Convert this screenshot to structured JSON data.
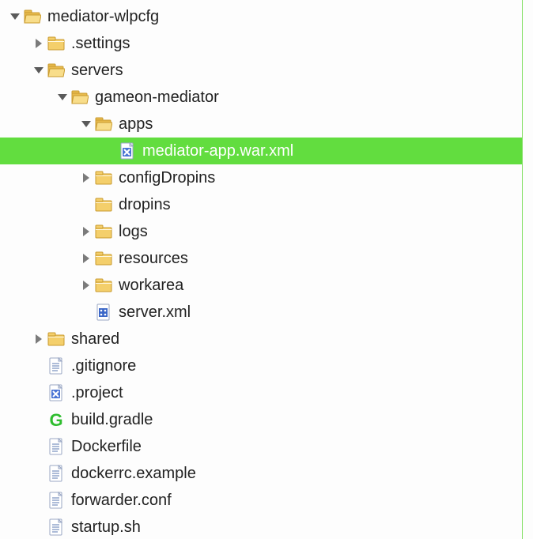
{
  "tree": [
    {
      "depth": 0,
      "arrow": "down",
      "icon": "folder-open",
      "label": "mediator-wlpcfg",
      "interact": true,
      "selected": false
    },
    {
      "depth": 1,
      "arrow": "right",
      "icon": "folder",
      "label": ".settings",
      "interact": true,
      "selected": false
    },
    {
      "depth": 1,
      "arrow": "down",
      "icon": "folder-open",
      "label": "servers",
      "interact": true,
      "selected": false
    },
    {
      "depth": 2,
      "arrow": "down",
      "icon": "folder-open",
      "label": "gameon-mediator",
      "interact": true,
      "selected": false
    },
    {
      "depth": 3,
      "arrow": "down",
      "icon": "folder-open",
      "label": "apps",
      "interact": true,
      "selected": false
    },
    {
      "depth": 4,
      "arrow": "none",
      "icon": "xml",
      "label": "mediator-app.war.xml",
      "interact": true,
      "selected": true
    },
    {
      "depth": 3,
      "arrow": "right",
      "icon": "folder",
      "label": "configDropins",
      "interact": true,
      "selected": false
    },
    {
      "depth": 3,
      "arrow": "none",
      "icon": "folder",
      "label": "dropins",
      "interact": true,
      "selected": false
    },
    {
      "depth": 3,
      "arrow": "right",
      "icon": "folder",
      "label": "logs",
      "interact": true,
      "selected": false
    },
    {
      "depth": 3,
      "arrow": "right",
      "icon": "folder",
      "label": "resources",
      "interact": true,
      "selected": false
    },
    {
      "depth": 3,
      "arrow": "right",
      "icon": "folder",
      "label": "workarea",
      "interact": true,
      "selected": false
    },
    {
      "depth": 3,
      "arrow": "none",
      "icon": "xml-blue",
      "label": "server.xml",
      "interact": true,
      "selected": false
    },
    {
      "depth": 1,
      "arrow": "right",
      "icon": "folder",
      "label": "shared",
      "interact": true,
      "selected": false
    },
    {
      "depth": 1,
      "arrow": "none",
      "icon": "file",
      "label": ".gitignore",
      "interact": true,
      "selected": false
    },
    {
      "depth": 1,
      "arrow": "none",
      "icon": "xml",
      "label": ".project",
      "interact": true,
      "selected": false
    },
    {
      "depth": 1,
      "arrow": "none",
      "icon": "gradle",
      "label": "build.gradle",
      "interact": true,
      "selected": false
    },
    {
      "depth": 1,
      "arrow": "none",
      "icon": "file",
      "label": "Dockerfile",
      "interact": true,
      "selected": false
    },
    {
      "depth": 1,
      "arrow": "none",
      "icon": "file",
      "label": "dockerrc.example",
      "interact": true,
      "selected": false
    },
    {
      "depth": 1,
      "arrow": "none",
      "icon": "file",
      "label": "forwarder.conf",
      "interact": true,
      "selected": false
    },
    {
      "depth": 1,
      "arrow": "none",
      "icon": "file",
      "label": "startup.sh",
      "interact": true,
      "selected": false
    }
  ],
  "indent_unit": 30,
  "base_indent": 12
}
